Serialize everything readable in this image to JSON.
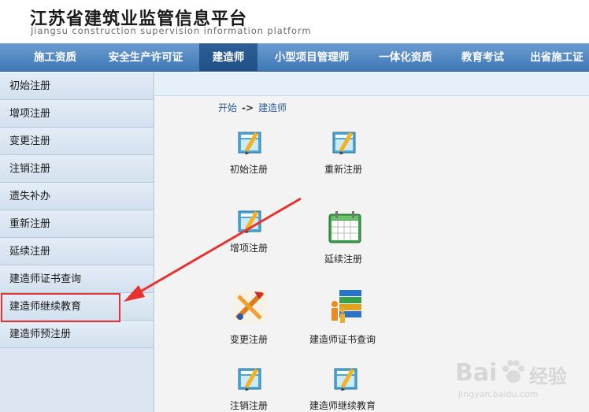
{
  "header": {
    "title": "江苏省建筑业监管信息平台",
    "subtitle": "Jiangsu construction supervision information platform"
  },
  "nav": {
    "items": [
      {
        "label": "施工资质"
      },
      {
        "label": "安全生产许可证"
      },
      {
        "label": "建造师",
        "active": true
      },
      {
        "label": "小型项目管理师"
      },
      {
        "label": "一体化资质"
      },
      {
        "label": "教育考试"
      },
      {
        "label": "出省施工证"
      }
    ]
  },
  "sidebar": {
    "items": [
      {
        "label": "初始注册"
      },
      {
        "label": "增项注册"
      },
      {
        "label": "变更注册"
      },
      {
        "label": "注销注册"
      },
      {
        "label": "遗失补办"
      },
      {
        "label": "重新注册"
      },
      {
        "label": "延续注册"
      },
      {
        "label": "建造师证书查询"
      },
      {
        "label": "建造师继续教育",
        "highlighted": true
      },
      {
        "label": "建造师预注册"
      }
    ]
  },
  "breadcrumb": {
    "start": "开始",
    "separator": "->",
    "current": "建造师"
  },
  "tiles": [
    {
      "label": "初始注册",
      "icon": "certificate-pencil-icon"
    },
    {
      "label": "重新注册",
      "icon": "certificate-pencil-icon"
    },
    {
      "label": "增项注册",
      "icon": "certificate-pencil-icon"
    },
    {
      "label": "延续注册",
      "icon": "calendar-icon"
    },
    {
      "label": "变更注册",
      "icon": "edit-tools-icon"
    },
    {
      "label": "建造师证书查询",
      "icon": "books-people-icon"
    },
    {
      "label": "注销注册",
      "icon": "certificate-pencil-icon"
    },
    {
      "label": "建造师继续教育",
      "icon": "certificate-pencil-icon"
    }
  ],
  "watermark": {
    "brand": "Bai",
    "brand2": "经验",
    "url": "jingyan.baidu.com"
  },
  "colors": {
    "nav_bg": "#4a84c2",
    "nav_active": "#245690",
    "sidebar_bg": "#dbe6f2",
    "highlight": "#e8322f",
    "link": "#2a5d99"
  }
}
